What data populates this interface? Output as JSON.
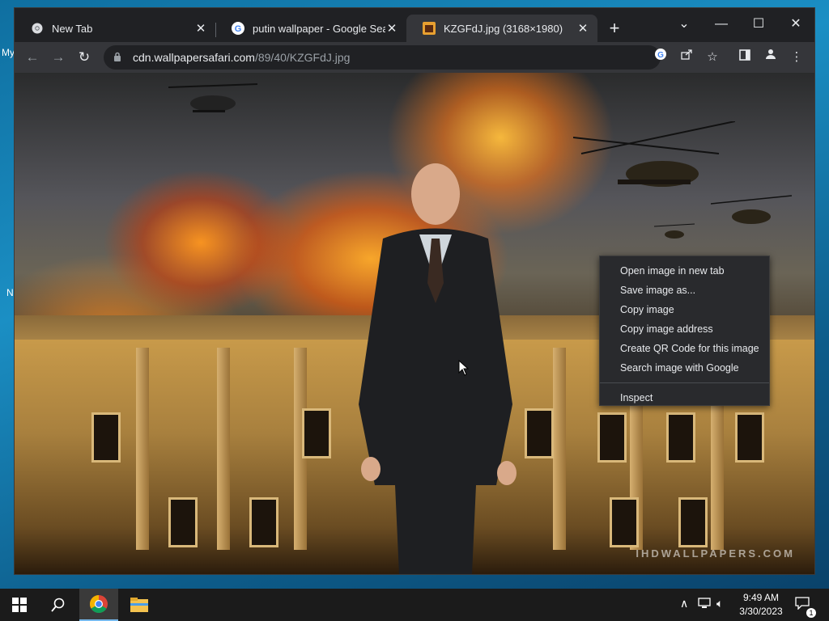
{
  "desktop": {
    "fragments": [
      "My",
      "N"
    ]
  },
  "tabs": [
    {
      "title": "New Tab",
      "favicon": "chrome-icon",
      "active": false
    },
    {
      "title": "putin wallpaper - Google Search",
      "favicon": "google-icon",
      "active": false
    },
    {
      "title": "KZGFdJ.jpg (3168×1980)",
      "favicon": "image-icon",
      "active": true
    }
  ],
  "window_controls": {
    "tab_search": "⌄",
    "minimize": "—",
    "maximize": "☐",
    "close": "✕"
  },
  "new_tab_symbol": "+",
  "toolbar": {
    "back": "←",
    "forward": "→",
    "reload": "↻",
    "url_domain": "cdn.wallpapersafari.com",
    "url_path": "/89/40/KZGFdJ.jpg"
  },
  "image": {
    "watermark": "IHDWALLPAPERS.COM"
  },
  "context_menu": {
    "items": [
      "Open image in new tab",
      "Save image as...",
      "Copy image",
      "Copy image address",
      "Create QR Code for this image",
      "Search image with Google"
    ],
    "inspect": "Inspect"
  },
  "taskbar": {
    "clock_time": "9:49 AM",
    "clock_date": "3/30/2023",
    "notification_count": "1"
  },
  "colors": {
    "tab_active": "#35363a",
    "titlebar": "#202124",
    "menu_bg": "#292a2d",
    "taskbar": "#1b1b1b"
  }
}
